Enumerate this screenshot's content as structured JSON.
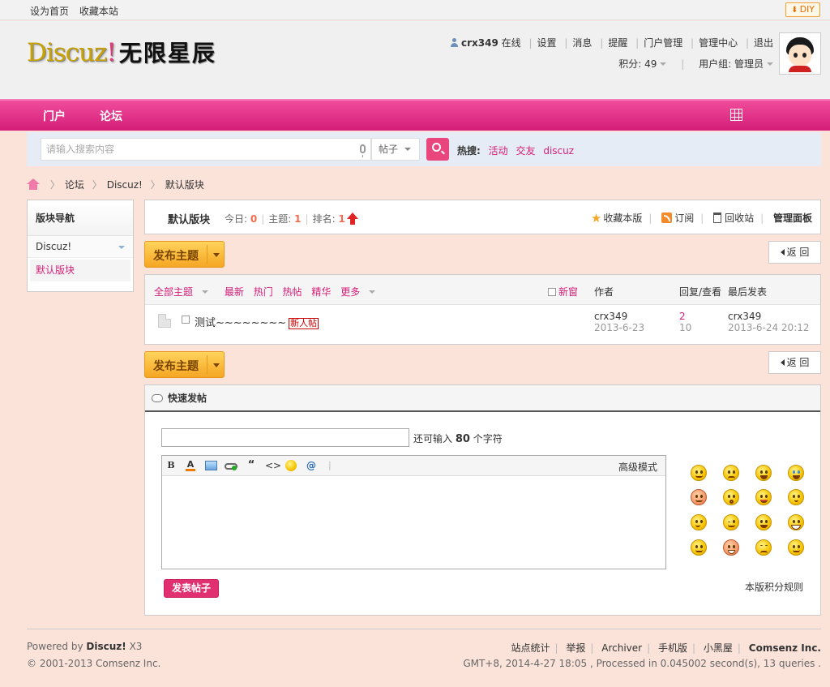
{
  "topbar": {
    "set_home": "设为首页",
    "bookmark": "收藏本站",
    "diy": "DIY"
  },
  "logo": {
    "main": "Discuz",
    "bang": "!",
    "cn": "无限星辰"
  },
  "user": {
    "name": "crx349",
    "status": "在线",
    "links": [
      "设置",
      "消息",
      "提醒",
      "门户管理",
      "管理中心",
      "退出"
    ],
    "credits": "积分: 49",
    "group": "用户组: 管理员"
  },
  "nav": {
    "portal": "门户",
    "forum": "论坛"
  },
  "search": {
    "placeholder": "请输入搜索内容",
    "type": "帖子",
    "hot_label": "热搜:",
    "hot": [
      "活动",
      "交友",
      "discuz"
    ]
  },
  "breadcrumb": [
    "论坛",
    "Discuz!",
    "默认版块"
  ],
  "sidebar": {
    "title": "版块导航",
    "group": "Discuz!",
    "active": "默认版块"
  },
  "forum": {
    "name": "默认版块",
    "today_label": "今日:",
    "today": "0",
    "threads_label": "主题:",
    "threads": "1",
    "rank_label": "排名:",
    "rank": "1",
    "favorite": "收藏本版",
    "subscribe": "订阅",
    "recycle": "回收站",
    "manage": "管理面板"
  },
  "buttons": {
    "post_new": "发布主题",
    "back": "返 回"
  },
  "threadlist": {
    "filters": [
      "全部主题",
      "最新",
      "热门",
      "热帖",
      "精华",
      "更多"
    ],
    "new_window": "新窗",
    "col_author": "作者",
    "col_replies": "回复/查看",
    "col_last": "最后发表",
    "rows": [
      {
        "subject": "测试~~~~~~~~",
        "badge": "新人帖",
        "author": "crx349",
        "date": "2013-6-23",
        "replies": "2",
        "views": "10",
        "last_user": "crx349",
        "last_date": "2013-6-24 20:12"
      }
    ]
  },
  "quickpost": {
    "title": "快速发帖",
    "remain_prefix": "还可输入",
    "remain": "80",
    "remain_suffix": "个字符",
    "advanced": "高级模式",
    "submit": "发表帖子",
    "rules": "本版积分规则",
    "toolbar_icons": [
      "bold-icon",
      "font-color-icon",
      "image-icon",
      "link-icon",
      "quote-icon",
      "code-icon",
      "smiley-icon",
      "at-icon"
    ]
  },
  "footer": {
    "powered": "Powered by",
    "product": "Discuz!",
    "version": "X3",
    "copyright": "© 2001-2013 Comsenz Inc.",
    "links": [
      "站点统计",
      "举报",
      "Archiver",
      "手机版",
      "小黑屋"
    ],
    "company": "Comsenz Inc.",
    "stats": "GMT+8, 2014-4-27 18:05 , Processed in 0.045002 second(s), 13 queries ."
  },
  "colors": {
    "brand": "#d41d78",
    "accent_orange": "#f5a623"
  }
}
